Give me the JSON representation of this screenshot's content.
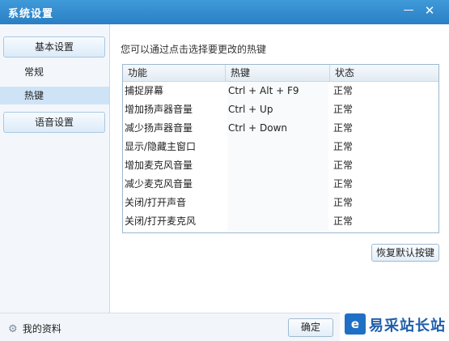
{
  "window": {
    "title": "系统设置",
    "minimize_glyph": "—",
    "close_glyph": "✕"
  },
  "sidebar": {
    "groups": [
      {
        "label": "基本设置"
      },
      {
        "label": "语音设置"
      }
    ],
    "items": [
      {
        "label": "常规"
      },
      {
        "label": "热键",
        "selected": true
      }
    ]
  },
  "main": {
    "hint": "您可以通过点击选择要更改的热键",
    "columns": [
      "功能",
      "热键",
      "状态"
    ],
    "rows": [
      {
        "name": "捕捉屏幕",
        "key": "Ctrl + Alt + F9",
        "status": "正常"
      },
      {
        "name": "增加扬声器音量",
        "key": "Ctrl + Up",
        "status": "正常"
      },
      {
        "name": "减少扬声器音量",
        "key": "Ctrl + Down",
        "status": "正常"
      },
      {
        "name": "显示/隐藏主窗口",
        "key": "",
        "status": "正常"
      },
      {
        "name": "增加麦克风音量",
        "key": "",
        "status": "正常"
      },
      {
        "name": "减少麦克风音量",
        "key": "",
        "status": "正常"
      },
      {
        "name": "关闭/打开声音",
        "key": "",
        "status": "正常"
      },
      {
        "name": "关闭/打开麦克风",
        "key": "",
        "status": "正常"
      }
    ],
    "restore_label": "恢复默认按键"
  },
  "footer": {
    "profile_icon": "gear-icon",
    "profile_label": "我的资料",
    "ok_label": "确定"
  },
  "watermark": {
    "logo_glyph": "e",
    "text": "易采站长站"
  },
  "colors": {
    "titlebar": "#2a7fc4",
    "selected_item": "#cfe3f6",
    "watermark_text": "#1f5fab"
  }
}
